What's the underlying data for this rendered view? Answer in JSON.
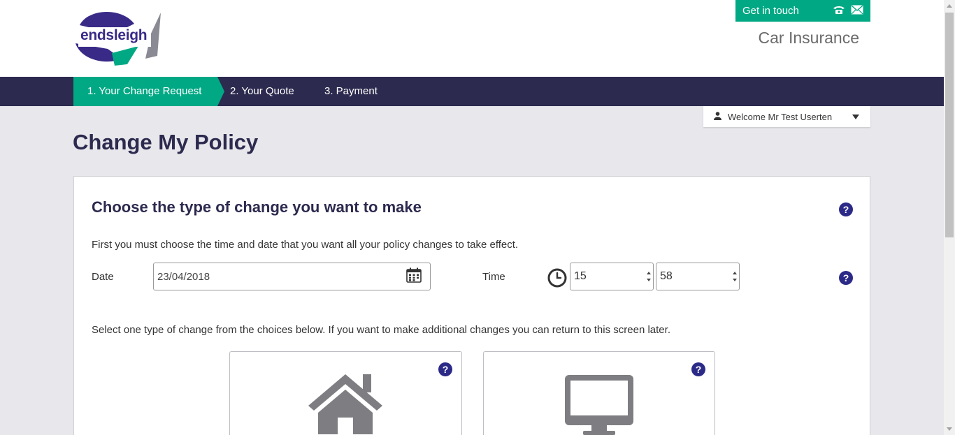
{
  "brand": {
    "logo_text": "endsleigh",
    "accent": "#00a884",
    "primary": "#2c2a4e"
  },
  "header": {
    "contact_label": "Get in touch",
    "contact_icons": [
      "phone-icon",
      "mail-icon"
    ],
    "product_title": "Car Insurance"
  },
  "steps": [
    {
      "label": "1. Your Change Request",
      "active": true
    },
    {
      "label": "2. Your Quote",
      "active": false
    },
    {
      "label": "3. Payment",
      "active": false
    }
  ],
  "user": {
    "welcome": "Welcome Mr Test Userten"
  },
  "page": {
    "title": "Change My Policy"
  },
  "panel": {
    "title": "Choose the type of change you want to make",
    "intro": "First you must choose the time and date that you want all your policy changes to take effect.",
    "date_label": "Date",
    "date_value": "23/04/2018",
    "time_label": "Time",
    "hour_value": "15",
    "minute_value": "58",
    "select_note": "Select one type of change from the choices below. If you want to make additional changes you can return to this screen later.",
    "choices": [
      {
        "icon": "house-icon"
      },
      {
        "icon": "monitor-icon"
      }
    ]
  }
}
